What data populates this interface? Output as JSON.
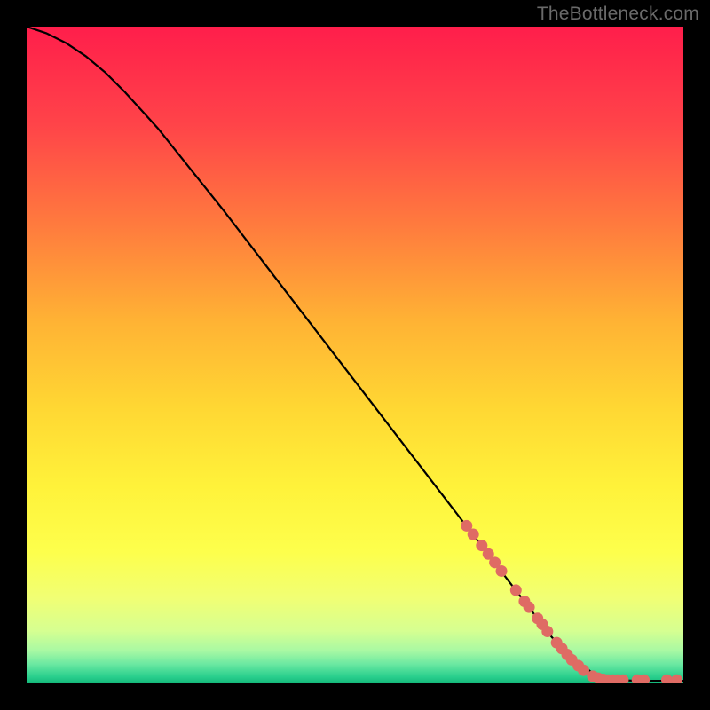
{
  "watermark": "TheBottleneck.com",
  "chart_data": {
    "type": "line",
    "title": "",
    "xlabel": "",
    "ylabel": "",
    "xlim": [
      0,
      100
    ],
    "ylim": [
      0,
      100
    ],
    "grid": false,
    "legend": false,
    "curve": [
      {
        "x": 0,
        "y": 100
      },
      {
        "x": 3,
        "y": 99
      },
      {
        "x": 6,
        "y": 97.5
      },
      {
        "x": 9,
        "y": 95.5
      },
      {
        "x": 12,
        "y": 93
      },
      {
        "x": 15,
        "y": 90
      },
      {
        "x": 20,
        "y": 84.5
      },
      {
        "x": 30,
        "y": 72
      },
      {
        "x": 40,
        "y": 59
      },
      {
        "x": 50,
        "y": 46
      },
      {
        "x": 60,
        "y": 33
      },
      {
        "x": 70,
        "y": 20
      },
      {
        "x": 75,
        "y": 13.5
      },
      {
        "x": 80,
        "y": 7
      },
      {
        "x": 83,
        "y": 4
      },
      {
        "x": 86,
        "y": 1.7
      },
      {
        "x": 88,
        "y": 0.9
      },
      {
        "x": 90,
        "y": 0.5
      },
      {
        "x": 93,
        "y": 0.4
      },
      {
        "x": 96,
        "y": 0.4
      },
      {
        "x": 100,
        "y": 0.4
      }
    ],
    "markers": [
      {
        "x": 67.0,
        "y": 24.0
      },
      {
        "x": 68.0,
        "y": 22.7
      },
      {
        "x": 69.3,
        "y": 21.0
      },
      {
        "x": 70.3,
        "y": 19.7
      },
      {
        "x": 71.3,
        "y": 18.4
      },
      {
        "x": 72.3,
        "y": 17.1
      },
      {
        "x": 74.5,
        "y": 14.2
      },
      {
        "x": 75.8,
        "y": 12.5
      },
      {
        "x": 76.5,
        "y": 11.6
      },
      {
        "x": 77.8,
        "y": 9.9
      },
      {
        "x": 78.5,
        "y": 9.0
      },
      {
        "x": 79.3,
        "y": 7.9
      },
      {
        "x": 80.7,
        "y": 6.2
      },
      {
        "x": 81.5,
        "y": 5.3
      },
      {
        "x": 82.3,
        "y": 4.4
      },
      {
        "x": 83.0,
        "y": 3.6
      },
      {
        "x": 84.0,
        "y": 2.7
      },
      {
        "x": 84.8,
        "y": 2.0
      },
      {
        "x": 86.2,
        "y": 1.1
      },
      {
        "x": 87.0,
        "y": 0.8
      },
      {
        "x": 87.8,
        "y": 0.6
      },
      {
        "x": 88.5,
        "y": 0.5
      },
      {
        "x": 89.3,
        "y": 0.5
      },
      {
        "x": 90.0,
        "y": 0.5
      },
      {
        "x": 90.8,
        "y": 0.5
      },
      {
        "x": 93.0,
        "y": 0.5
      },
      {
        "x": 94.0,
        "y": 0.5
      },
      {
        "x": 97.5,
        "y": 0.5
      },
      {
        "x": 99.0,
        "y": 0.5
      }
    ],
    "gradient_stops": [
      {
        "offset": 0,
        "color": "#ff1e4b"
      },
      {
        "offset": 15,
        "color": "#ff4449"
      },
      {
        "offset": 30,
        "color": "#ff7a3e"
      },
      {
        "offset": 45,
        "color": "#ffb334"
      },
      {
        "offset": 58,
        "color": "#ffd733"
      },
      {
        "offset": 70,
        "color": "#fff23a"
      },
      {
        "offset": 80,
        "color": "#fdff4c"
      },
      {
        "offset": 87,
        "color": "#f1ff74"
      },
      {
        "offset": 92,
        "color": "#d6ff91"
      },
      {
        "offset": 95,
        "color": "#a9f9a3"
      },
      {
        "offset": 97,
        "color": "#6de9a2"
      },
      {
        "offset": 99,
        "color": "#29cf8d"
      },
      {
        "offset": 100,
        "color": "#14b87a"
      }
    ],
    "marker_color": "#df6b64",
    "curve_color": "#000000"
  }
}
